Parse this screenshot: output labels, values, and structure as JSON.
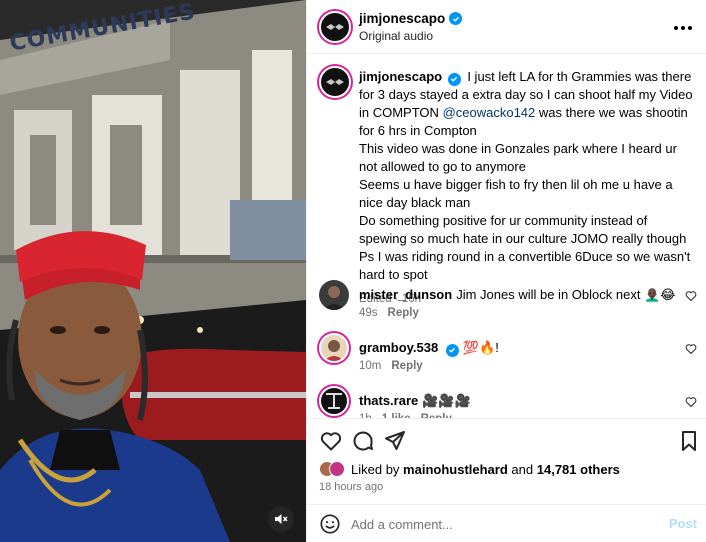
{
  "media": {
    "mural_text": "COMMUNITIES",
    "mute_icon": "speaker-muted-icon"
  },
  "header": {
    "username": "jimjonescapo",
    "subtitle": "Original audio",
    "more_icon": "more-horizontal-icon"
  },
  "caption": {
    "username": "jimjonescapo",
    "text_part1": "I just left LA for th Grammies was there for 3 days stayed a extra day so I can shoot half my Video in COMPTON ",
    "mention": "@ceowacko142",
    "text_part2": " was there we was shootin for 6 hrs in Compton",
    "line2": "This video was done in Gonzales park where I heard ur not allowed to go to anymore",
    "line3": "Seems u have bigger fish to fry then lil oh me u have a nice day black man",
    "line4": "Do something positive for ur community instead of spewing so much hate in our culture JOMO really though",
    "line5": "Ps I was riding round in a convertible 6Duce so we wasn't hard to spot",
    "meta": "Edited · 16h"
  },
  "comments": [
    {
      "username": "mister_dunson",
      "text": "Jim Jones will be in Oblock next 👨🏿‍🦲😂",
      "time": "49s",
      "likes": "",
      "reply": "Reply"
    },
    {
      "username": "gramboy.538",
      "text": "💯🔥!",
      "time": "10m",
      "likes": "",
      "reply": "Reply"
    },
    {
      "username": "thats.rare",
      "text": "🎥🎥🎥",
      "time": "1h",
      "likes": "1 like",
      "reply": "Reply"
    }
  ],
  "actions": {
    "like_icon": "heart-icon",
    "comment_icon": "comment-icon",
    "share_icon": "paper-plane-icon",
    "save_icon": "bookmark-icon",
    "liked_by_prefix": "Liked by",
    "liked_by_user": "mainohustlehard",
    "liked_by_and": "and",
    "liked_by_others": "14,781 others",
    "time": "18 hours ago"
  },
  "comment_bar": {
    "emoji_icon": "emoji-smile-icon",
    "placeholder": "Add a comment...",
    "post_label": "Post"
  },
  "colors": {
    "verified": "#0095f6",
    "link": "#00376b",
    "muted": "#737373",
    "post_disabled": "#b2dffc",
    "avatar_ring": "#d6249f"
  }
}
